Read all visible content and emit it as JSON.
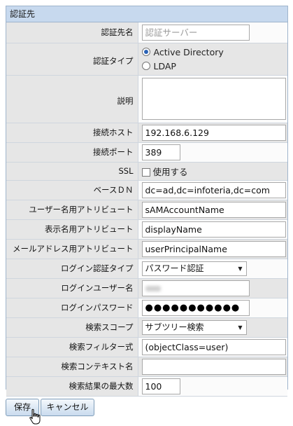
{
  "panel_title": "認証先",
  "fields": {
    "name": {
      "label": "認証先名",
      "placeholder": "認証サーバー"
    },
    "type": {
      "label": "認証タイプ",
      "options": [
        "Active Directory",
        "LDAP"
      ],
      "selected": "Active Directory"
    },
    "description": {
      "label": "説明",
      "value": ""
    },
    "host": {
      "label": "接続ホスト",
      "value": "192.168.6.129"
    },
    "port": {
      "label": "接続ポート",
      "value": "389"
    },
    "ssl": {
      "label": "SSL",
      "checkbox_label": "使用する",
      "checked": false
    },
    "base_dn": {
      "label": "ベースＤＮ",
      "value": "dc=ad,dc=infoteria,dc=com"
    },
    "user_attr": {
      "label": "ユーザー名用アトリビュート",
      "value": "sAMAccountName"
    },
    "display_attr": {
      "label": "表示名用アトリビュート",
      "value": "displayName"
    },
    "mail_attr": {
      "label": "メールアドレス用アトリビュート",
      "value": "userPrincipalName"
    },
    "login_type": {
      "label": "ログイン認証タイプ",
      "value": "パスワード認証"
    },
    "login_user": {
      "label": "ログインユーザー名"
    },
    "login_password": {
      "label": "ログインパスワード",
      "value": "●●●●●●●●●●●"
    },
    "search_scope": {
      "label": "検索スコープ",
      "value": "サブツリー検索"
    },
    "search_filter": {
      "label": "検索フィルター式",
      "value": "(objectClass=user)"
    },
    "search_context": {
      "label": "検索コンテキスト名",
      "value": ""
    },
    "max_results": {
      "label": "検索結果の最大数",
      "value": "100"
    }
  },
  "buttons": {
    "save": "保存",
    "cancel": "キャンセル"
  },
  "colors": {
    "header_bg": "#c7d9ee",
    "border": "#9fb4cc",
    "label_bg": "#e6e6e6",
    "radio_accent": "#2a62b6"
  }
}
